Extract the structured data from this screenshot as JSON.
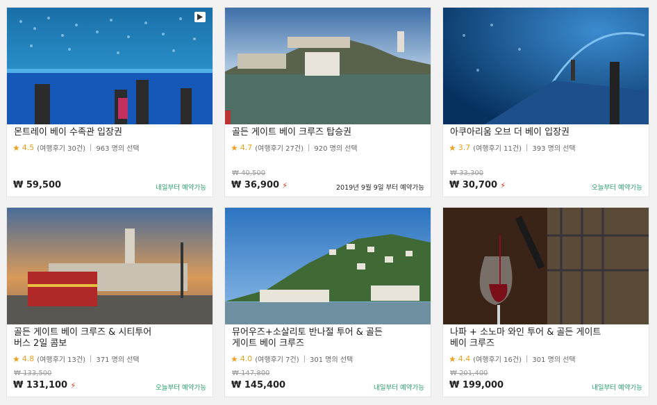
{
  "colors": {
    "accent_star": "#f0a020",
    "available_green": "#2aa36b",
    "bolt_red": "#e6462e"
  },
  "cards": [
    {
      "title": "몬트레이 베이 수족관 입장권",
      "rating": "4.5",
      "reviews": "(여행후기 30건)",
      "chosen": "963 명의 선택",
      "original_price": "",
      "price": "₩ 59,500",
      "hot": false,
      "availability": "내일부터 예약가능",
      "availability_style": "green",
      "icons": [
        "play-icon"
      ]
    },
    {
      "title": "골든 게이트 베이 크루즈 탑승권",
      "rating": "4.7",
      "reviews": "(여행후기 27건)",
      "chosen": "920 명의 선택",
      "original_price": "₩ 40,500",
      "price": "₩ 36,900",
      "hot": true,
      "availability": "2019년 9월 9일 부터 예약가능",
      "availability_style": "date"
    },
    {
      "title": "아쿠아리움 오브 더 베이 입장권",
      "rating": "3.7",
      "reviews": "(여행후기 11건)",
      "chosen": "393 명의 선택",
      "original_price": "₩ 33,300",
      "price": "₩ 30,700",
      "hot": true,
      "availability": "오늘부터 예약가능",
      "availability_style": "green"
    },
    {
      "title": "골든 게이트 베이 크루즈 & 시티투어\n버스 2일 콤보",
      "rating": "4.8",
      "reviews": "(여행후기 13건)",
      "chosen": "371 명의 선택",
      "original_price": "₩ 133,500",
      "price": "₩ 131,100",
      "hot": true,
      "availability": "오늘부터 예약가능",
      "availability_style": "green"
    },
    {
      "title": "뮤어우즈+소살리토 반나절 투어 & 골든\n게이트 베이 크루즈",
      "rating": "4.0",
      "reviews": "(여행후기 7건)",
      "chosen": "301 명의 선택",
      "original_price": "₩ 147,800",
      "price": "₩ 145,400",
      "hot": false,
      "availability": "내일부터 예약가능",
      "availability_style": "green"
    },
    {
      "title": "나파 + 소노마 와인 투어 & 골든 게이트\n베이 크루즈",
      "rating": "4.4",
      "reviews": "(여행후기 16건)",
      "chosen": "301 명의 선택",
      "original_price": "₩ 201,400",
      "price": "₩ 199,000",
      "hot": false,
      "availability": "내일부터 예약가능",
      "availability_style": "green"
    }
  ],
  "glyphs": {
    "star": "★",
    "bolt": "⚡",
    "separator": "|"
  }
}
